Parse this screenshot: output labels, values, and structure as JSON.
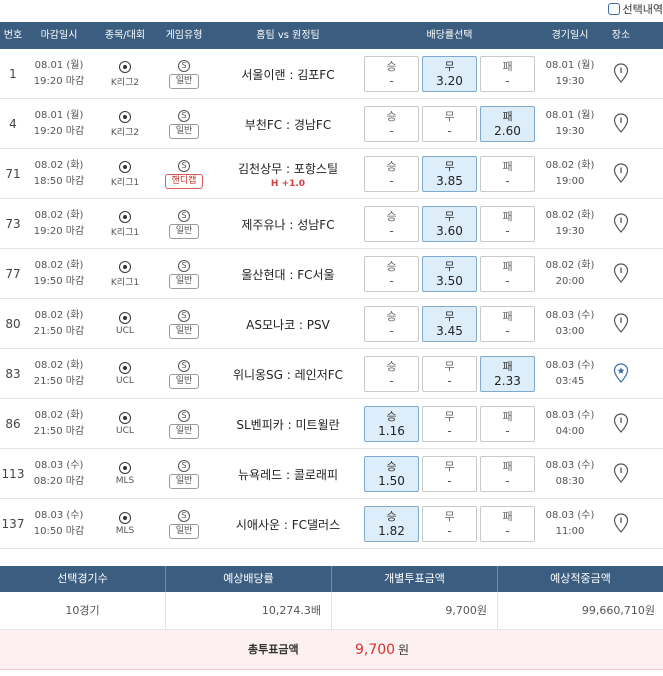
{
  "select_toggle": {
    "label": "선택내역"
  },
  "headers": {
    "no": "번호",
    "deadline": "마감일시",
    "league": "종목/대회",
    "game_type": "게임유형",
    "match": "홈팀 vs 원정팀",
    "odds": "배당률선택",
    "game_date": "경기일시",
    "venue": "장소"
  },
  "rows": [
    {
      "no": "1",
      "deadline_date": "08.01 (월)",
      "deadline_time": "19:20 마감",
      "league": "K리그2",
      "type_icon": "S",
      "type": "일반",
      "type_class": "",
      "handicap": "",
      "match": "서울이랜 : 김포FC",
      "win_label": "승",
      "win": "-",
      "draw_label": "무",
      "draw": "3.20",
      "lose_label": "패",
      "lose": "-",
      "selected": "draw",
      "game_date": "08.01 (월)",
      "game_time": "19:30",
      "venue_icon": "location-pin-icon"
    },
    {
      "no": "4",
      "deadline_date": "08.01 (월)",
      "deadline_time": "19:20 마감",
      "league": "K리그2",
      "type_icon": "S",
      "type": "일반",
      "type_class": "",
      "handicap": "",
      "match": "부천FC : 경남FC",
      "win_label": "승",
      "win": "-",
      "draw_label": "무",
      "draw": "-",
      "lose_label": "패",
      "lose": "2.60",
      "selected": "lose",
      "game_date": "08.01 (월)",
      "game_time": "19:30",
      "venue_icon": "location-pin-icon"
    },
    {
      "no": "71",
      "deadline_date": "08.02 (화)",
      "deadline_time": "18:50 마감",
      "league": "K리그1",
      "type_icon": "S",
      "type": "핸디캡",
      "type_class": "hc",
      "handicap": "H +1.0",
      "match": "김천상무 : 포항스틸",
      "win_label": "승",
      "win": "-",
      "draw_label": "무",
      "draw": "3.85",
      "lose_label": "패",
      "lose": "-",
      "selected": "draw",
      "game_date": "08.02 (화)",
      "game_time": "19:00",
      "venue_icon": "location-pin-icon"
    },
    {
      "no": "73",
      "deadline_date": "08.02 (화)",
      "deadline_time": "19:20 마감",
      "league": "K리그1",
      "type_icon": "S",
      "type": "일반",
      "type_class": "",
      "handicap": "",
      "match": "제주유나 : 성남FC",
      "win_label": "승",
      "win": "-",
      "draw_label": "무",
      "draw": "3.60",
      "lose_label": "패",
      "lose": "-",
      "selected": "draw",
      "game_date": "08.02 (화)",
      "game_time": "19:30",
      "venue_icon": "location-pin-icon"
    },
    {
      "no": "77",
      "deadline_date": "08.02 (화)",
      "deadline_time": "19:50 마감",
      "league": "K리그1",
      "type_icon": "S",
      "type": "일반",
      "type_class": "",
      "handicap": "",
      "match": "울산현대 : FC서울",
      "win_label": "승",
      "win": "-",
      "draw_label": "무",
      "draw": "3.50",
      "lose_label": "패",
      "lose": "-",
      "selected": "draw",
      "game_date": "08.02 (화)",
      "game_time": "20:00",
      "venue_icon": "location-pin-icon"
    },
    {
      "no": "80",
      "deadline_date": "08.02 (화)",
      "deadline_time": "21:50 마감",
      "league": "UCL",
      "type_icon": "S",
      "type": "일반",
      "type_class": "",
      "handicap": "",
      "match": "AS모나코 : PSV",
      "win_label": "승",
      "win": "-",
      "draw_label": "무",
      "draw": "3.45",
      "lose_label": "패",
      "lose": "-",
      "selected": "draw",
      "game_date": "08.03 (수)",
      "game_time": "03:00",
      "venue_icon": "location-pin-icon"
    },
    {
      "no": "83",
      "deadline_date": "08.02 (화)",
      "deadline_time": "21:50 마감",
      "league": "UCL",
      "type_icon": "S",
      "type": "일반",
      "type_class": "",
      "handicap": "",
      "match": "위니옹SG : 레인저FC",
      "win_label": "승",
      "win": "-",
      "draw_label": "무",
      "draw": "-",
      "lose_label": "패",
      "lose": "2.33",
      "selected": "lose",
      "game_date": "08.03 (수)",
      "game_time": "03:45",
      "venue_icon": "location-star-icon"
    },
    {
      "no": "86",
      "deadline_date": "08.02 (화)",
      "deadline_time": "21:50 마감",
      "league": "UCL",
      "type_icon": "S",
      "type": "일반",
      "type_class": "",
      "handicap": "",
      "match": "SL벤피카 : 미트윌란",
      "win_label": "승",
      "win": "1.16",
      "draw_label": "무",
      "draw": "-",
      "lose_label": "패",
      "lose": "-",
      "selected": "win",
      "game_date": "08.03 (수)",
      "game_time": "04:00",
      "venue_icon": "location-pin-icon"
    },
    {
      "no": "113",
      "deadline_date": "08.03 (수)",
      "deadline_time": "08:20 마감",
      "league": "MLS",
      "type_icon": "S",
      "type": "일반",
      "type_class": "",
      "handicap": "",
      "match": "뉴욕레드 : 콜로래피",
      "win_label": "승",
      "win": "1.50",
      "draw_label": "무",
      "draw": "-",
      "lose_label": "패",
      "lose": "-",
      "selected": "win",
      "game_date": "08.03 (수)",
      "game_time": "08:30",
      "venue_icon": "location-pin-icon"
    },
    {
      "no": "137",
      "deadline_date": "08.03 (수)",
      "deadline_time": "10:50 마감",
      "league": "MLS",
      "type_icon": "S",
      "type": "일반",
      "type_class": "",
      "handicap": "",
      "match": "시애사운 : FC댈러스",
      "win_label": "승",
      "win": "1.82",
      "draw_label": "무",
      "draw": "-",
      "lose_label": "패",
      "lose": "-",
      "selected": "win",
      "game_date": "08.03 (수)",
      "game_time": "11:00",
      "venue_icon": "location-pin-icon"
    }
  ],
  "summary": {
    "headers": [
      "선택경기수",
      "예상배당률",
      "개별투표금액",
      "예상적중금액"
    ],
    "values": [
      "10경기",
      "10,274.3배",
      "9,700원",
      "99,660,710원"
    ],
    "total_label": "총투표금액",
    "total_amount": "9,700",
    "total_unit": "원"
  },
  "colors": {
    "header_bg": "#3b5d7f",
    "selected_odds_bg": "#ddeefa",
    "total_amount": "#d63232",
    "handicap": "#c0392b"
  }
}
